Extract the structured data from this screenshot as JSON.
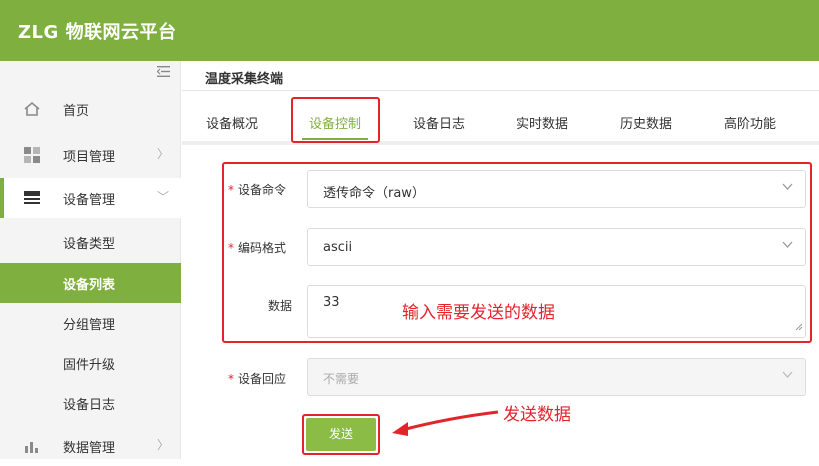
{
  "app": {
    "logo": "ZLG 物联网云平台"
  },
  "sidebar": {
    "items": [
      {
        "label": "首页",
        "icon": "home-icon"
      },
      {
        "label": "项目管理",
        "icon": "grid-icon",
        "arrow": "〉"
      },
      {
        "label": "设备管理",
        "icon": "device-icon",
        "arrow": "﹀"
      }
    ],
    "sub_items": [
      "设备类型",
      "设备列表",
      "分组管理",
      "固件升级",
      "设备日志"
    ],
    "bottom_item": {
      "label": "数据管理",
      "icon": "bar-chart-icon",
      "arrow": "〉"
    }
  },
  "header": {
    "title": "温度采集终端"
  },
  "tabs": [
    "设备概况",
    "设备控制",
    "设备日志",
    "实时数据",
    "历史数据",
    "高阶功能"
  ],
  "form": {
    "required_mark": "*",
    "command_label": "设备命令",
    "command_value": "透传命令（raw）",
    "encoding_label": "编码格式",
    "encoding_value": "ascii",
    "data_label": "数据",
    "data_value": "33",
    "reply_label": "设备回应",
    "reply_value": "不需要",
    "send_label": "发送"
  },
  "annotations": {
    "input_note": "输入需要发送的数据",
    "send_note": "发送数据"
  },
  "colors": {
    "brand": "#7fb03f",
    "annotation": "#e3242b"
  }
}
